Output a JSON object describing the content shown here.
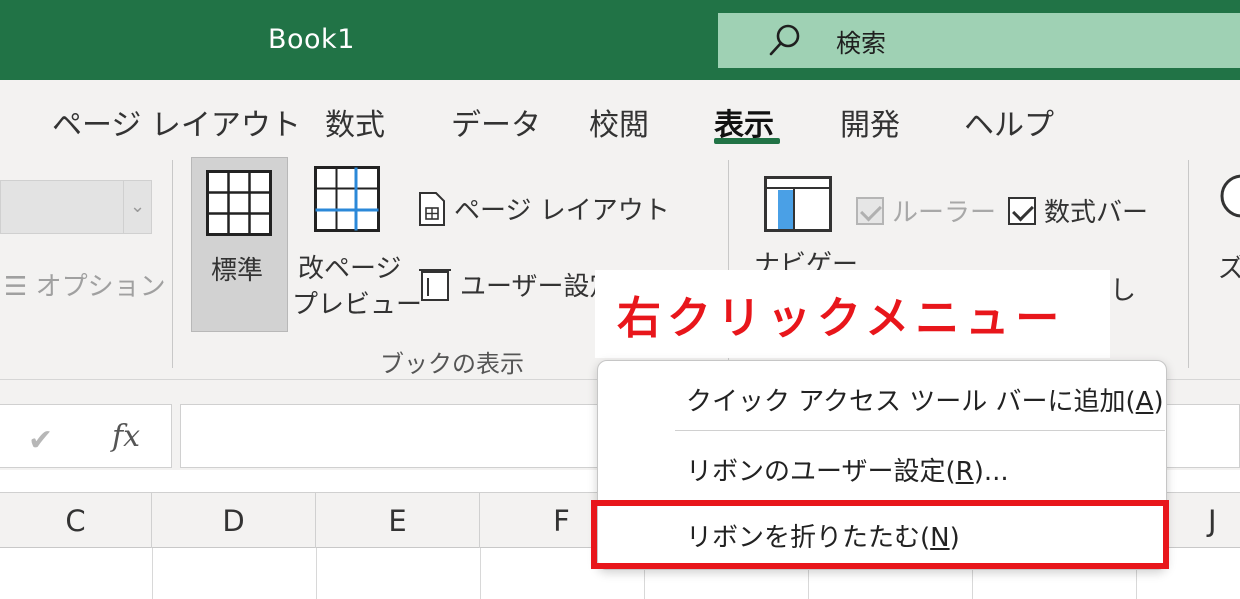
{
  "titlebar": {
    "document_title": "Book1",
    "search_icon": "search-icon",
    "search_text": "検索"
  },
  "tabs": [
    {
      "label": "ページ レイアウト",
      "active": false
    },
    {
      "label": "数式",
      "active": false
    },
    {
      "label": "データ",
      "active": false
    },
    {
      "label": "校閲",
      "active": false
    },
    {
      "label": "表示",
      "active": true
    },
    {
      "label": "開発",
      "active": false
    },
    {
      "label": "ヘルプ",
      "active": false
    }
  ],
  "ribbon": {
    "options_label": "オプション",
    "workbook_views": {
      "normal_label": "標準",
      "page_break_line1": "改ページ",
      "page_break_line2": "プレビュー",
      "page_layout_label": "ページ レイアウト",
      "custom_views_label": "ユーザー設定",
      "group_label": "ブックの表示"
    },
    "show": {
      "navigation_label": "ナビゲー",
      "ruler_label": "ルーラー",
      "ruler_checked": true,
      "ruler_disabled": true,
      "formula_bar_label": "数式バー",
      "formula_bar_checked": true,
      "partial_text": "し"
    },
    "zoom_partial": "ズ"
  },
  "formula_bar": {
    "enter_icon": "check-icon",
    "fx_label": "fx",
    "value": ""
  },
  "columns": [
    "C",
    "D",
    "E",
    "F",
    "J"
  ],
  "annotation": {
    "banner_text": "右クリックメニュー",
    "color": "#e8161b"
  },
  "context_menu": {
    "items": [
      {
        "text": "クイック アクセス ツール バーに追加(",
        "key": "A",
        "suffix": ")"
      },
      {
        "text": "リボンのユーザー設定(",
        "key": "R",
        "suffix": ")..."
      },
      {
        "text": "リボンを折りたたむ(",
        "key": "N",
        "suffix": ")",
        "highlighted": true
      }
    ]
  },
  "colors": {
    "accent_green": "#217346",
    "search_bg": "#9fd1b4",
    "ribbon_bg": "#f3f2f1"
  }
}
